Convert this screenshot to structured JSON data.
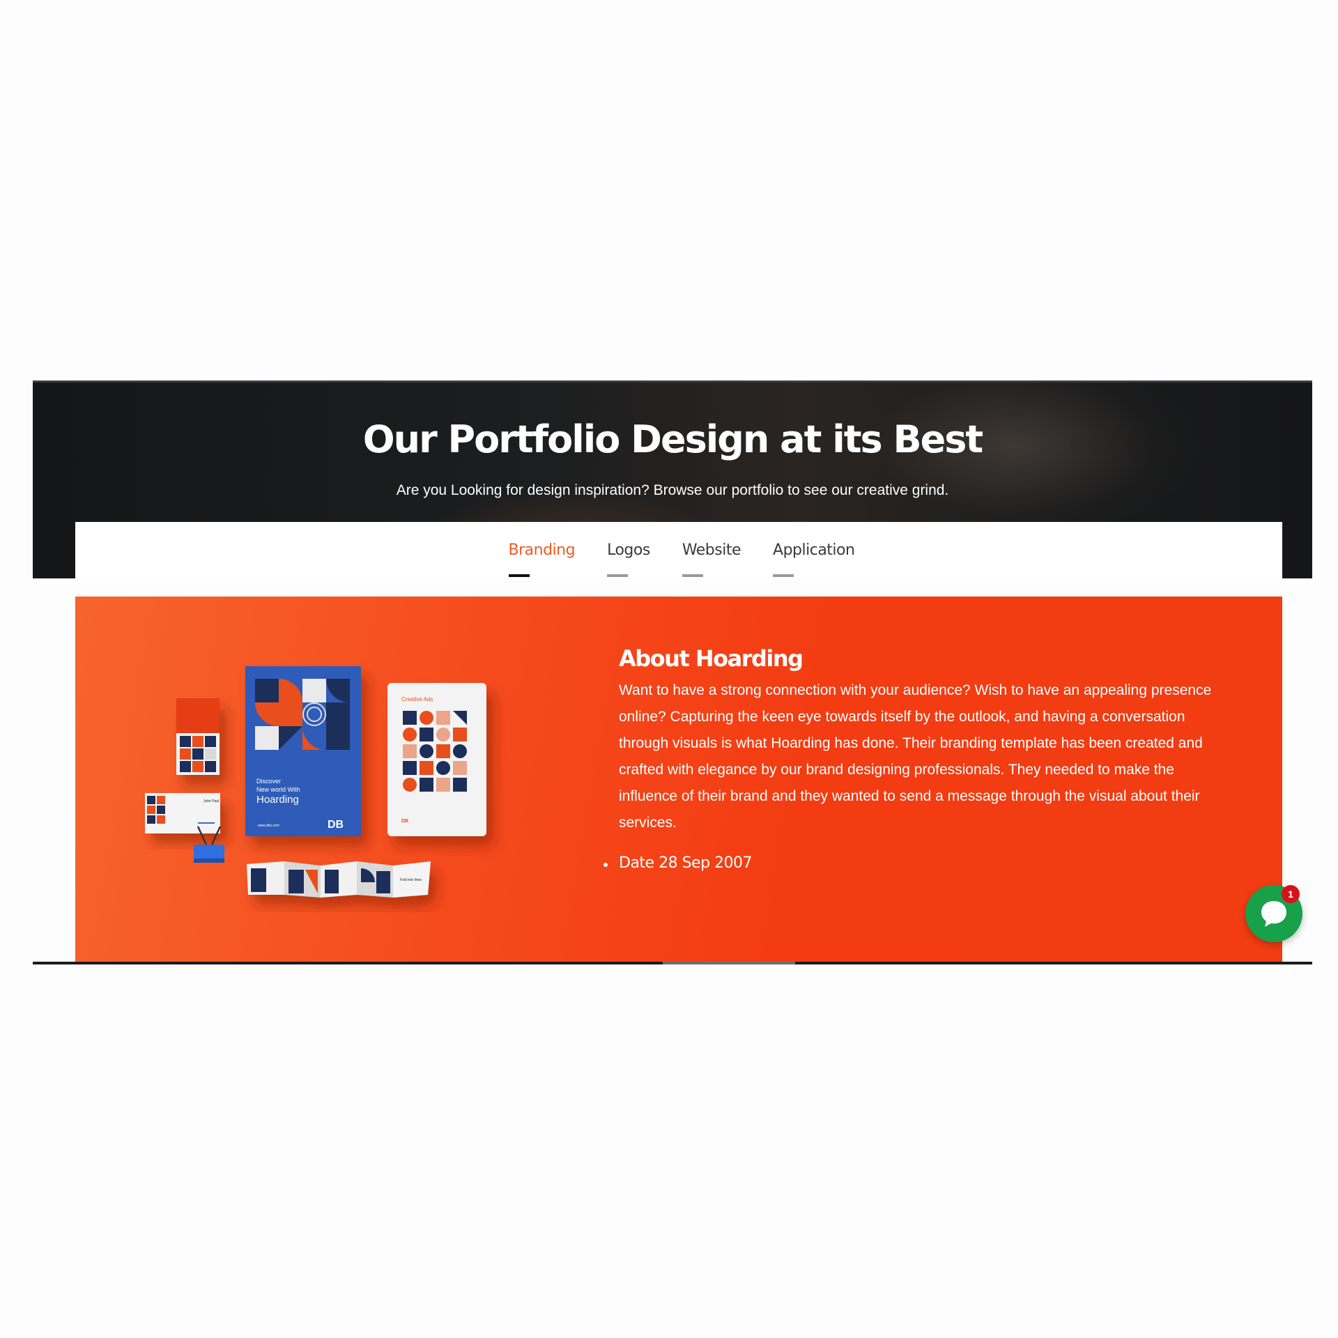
{
  "hero": {
    "title": "Our Portfolio Design at its Best",
    "subtitle": "Are you Looking for design inspiration? Browse our portfolio to see our creative grind."
  },
  "tabs": [
    {
      "label": "Branding",
      "active": true
    },
    {
      "label": "Logos",
      "active": false
    },
    {
      "label": "Website",
      "active": false
    },
    {
      "label": "Application",
      "active": false
    }
  ],
  "feature": {
    "title": "About Hoarding",
    "body": "Want to have a strong connection with your audience? Wish to have an appealing presence online? Capturing the keen eye towards itself by the outlook, and having a conversation through visuals is what Hoarding has done. Their branding template has been created and crafted with elegance by our brand designing professionals. They needed to make the influence of their brand and they wanted to send a message through the visual about their services.",
    "details": [
      "Date 28 Sep 2007"
    ],
    "mockup": {
      "poster_line1": "Discover",
      "poster_line2": "New world With",
      "poster_line3": "Hoarding",
      "poster_url": "www.dbs.com",
      "poster_logo": "DB",
      "notebook_title": "Creative Ads",
      "notebook_logo": "DB",
      "card_name": "John Paul",
      "banner_text": "Fold into lines"
    }
  },
  "chat": {
    "icon": "chat-bubble-icon",
    "badge_count": "1"
  },
  "colors": {
    "accent": "#ef5a22",
    "feature_bg": "#f33c12",
    "hero_bg": "#151617",
    "chat": "#18a04b",
    "badge": "#d5131b"
  }
}
